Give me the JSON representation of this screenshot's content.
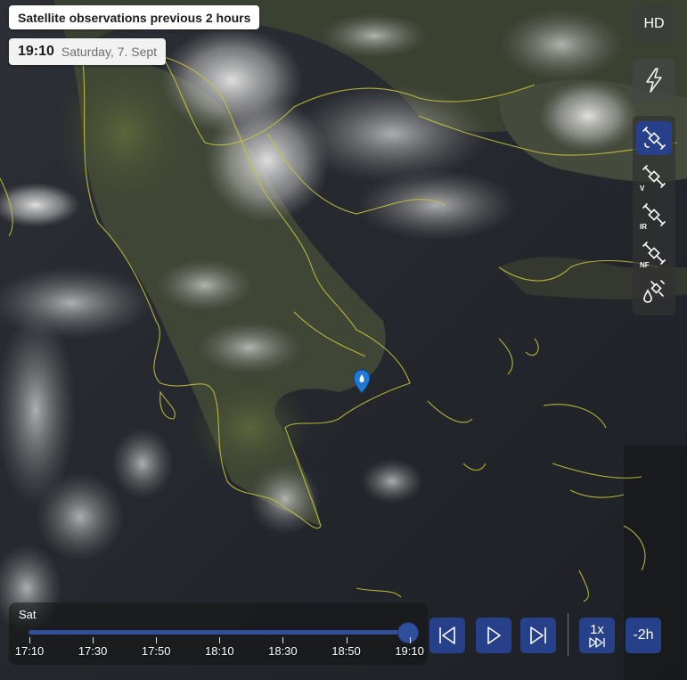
{
  "header": {
    "title": "Satellite observations previous 2 hours",
    "time": "19:10",
    "date": "Saturday, 7. Sept"
  },
  "right_toolbar": {
    "hd_label": "HD",
    "lightning_icon": "bolt-icon",
    "layers": [
      {
        "icon": "satellite-icon",
        "badge": "",
        "active": true
      },
      {
        "icon": "satellite-icon",
        "badge": "V",
        "active": false
      },
      {
        "icon": "satellite-icon",
        "badge": "IR",
        "active": false
      },
      {
        "icon": "satellite-icon",
        "badge": "NF",
        "active": false
      },
      {
        "icon": "satellite-drop-icon",
        "badge": "",
        "active": false
      }
    ]
  },
  "timeline": {
    "day": "Sat",
    "ticks": [
      "17:10",
      "17:30",
      "17:50",
      "18:10",
      "18:30",
      "18:50",
      "19:10"
    ],
    "current_index": 6
  },
  "controls": {
    "skip_back_icon": "skip-back-icon",
    "play_icon": "play-icon",
    "skip_forward_icon": "skip-forward-icon",
    "speed_label": "1x",
    "speed_icon": "fast-forward-icon",
    "range_label": "-2h"
  },
  "colors": {
    "accent": "#26418a",
    "borders": "#c8c23a",
    "marker": "#1f7ad6"
  }
}
